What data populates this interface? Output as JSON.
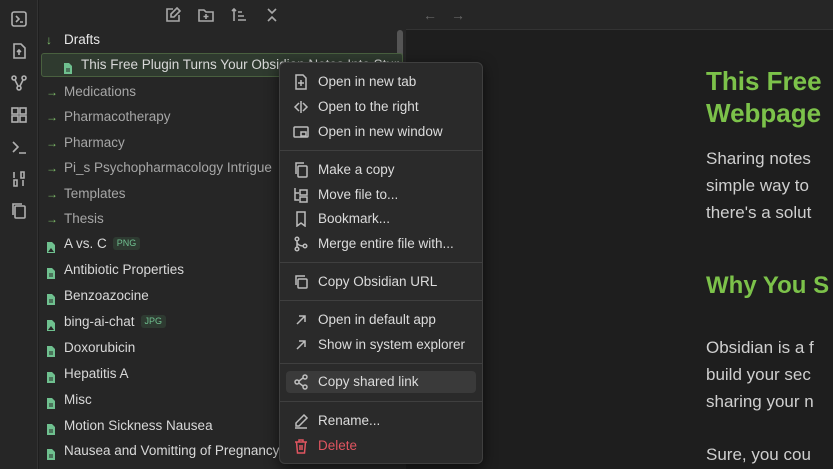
{
  "ribbon": {
    "icons": [
      "switcher-icon",
      "open-file-icon",
      "graph-icon",
      "canvas-icon",
      "terminal-icon",
      "binary-icon",
      "pages-icon"
    ]
  },
  "sidebar": {
    "toolbar": [
      "new-note-icon",
      "new-folder-icon",
      "sort-icon",
      "collapse-all-icon"
    ],
    "folders": [
      {
        "label": "Drafts",
        "open": true
      },
      {
        "label": "Medications",
        "open": false
      },
      {
        "label": "Pharmacotherapy",
        "open": false
      },
      {
        "label": "Pharmacy",
        "open": false
      },
      {
        "label": "Pi_s Psychopharmacology Intrigue",
        "open": false
      },
      {
        "label": "Templates",
        "open": false
      },
      {
        "label": "Thesis",
        "open": false
      }
    ],
    "active_file": "This Free Plugin Turns Your Obsidian Notes Into Stunning Webpages",
    "files": [
      {
        "label": "A vs. C",
        "badge": "PNG",
        "type": "image"
      },
      {
        "label": "Antibiotic Properties",
        "badge": "",
        "type": "note"
      },
      {
        "label": "Benzoazocine",
        "badge": "",
        "type": "note"
      },
      {
        "label": "bing-ai-chat",
        "badge": "JPG",
        "type": "image"
      },
      {
        "label": "Doxorubicin",
        "badge": "",
        "type": "note"
      },
      {
        "label": "Hepatitis A",
        "badge": "",
        "type": "note"
      },
      {
        "label": "Misc",
        "badge": "",
        "type": "note"
      },
      {
        "label": "Motion Sickness Nausea",
        "badge": "",
        "type": "note"
      },
      {
        "label": "Nausea and Vomitting of Pregnancy",
        "badge": "",
        "type": "note"
      }
    ]
  },
  "editor": {
    "title_line1": "This Free",
    "title_line2": "Webpage",
    "para1_line1": "Sharing notes",
    "para1_line2": "simple way to",
    "para1_line3": "there's a solut",
    "heading2": "Why You S",
    "para2_line1": "Obsidian is a f",
    "para2_line2": "build your sec",
    "para2_line3": "sharing your n",
    "para3_line1": "Sure, you cou"
  },
  "context_menu": {
    "items": [
      {
        "label": "Open in new tab",
        "icon": "new-tab-icon"
      },
      {
        "label": "Open to the right",
        "icon": "split-right-icon"
      },
      {
        "label": "Open in new window",
        "icon": "new-window-icon"
      },
      {
        "label": "Make a copy",
        "icon": "copy-file-icon"
      },
      {
        "label": "Move file to...",
        "icon": "move-file-icon"
      },
      {
        "label": "Bookmark...",
        "icon": "bookmark-icon"
      },
      {
        "label": "Merge entire file with...",
        "icon": "merge-icon"
      },
      {
        "label": "Copy Obsidian URL",
        "icon": "link-copy-icon"
      },
      {
        "label": "Open in default app",
        "icon": "external-arrow-icon"
      },
      {
        "label": "Show in system explorer",
        "icon": "explorer-arrow-icon"
      },
      {
        "label": "Copy shared link",
        "icon": "share-icon"
      },
      {
        "label": "Rename...",
        "icon": "pencil-icon"
      },
      {
        "label": "Delete",
        "icon": "trash-icon"
      }
    ]
  },
  "colors": {
    "accent": "#7cc24a",
    "danger": "#e05560",
    "badge": "#6fc08f"
  }
}
